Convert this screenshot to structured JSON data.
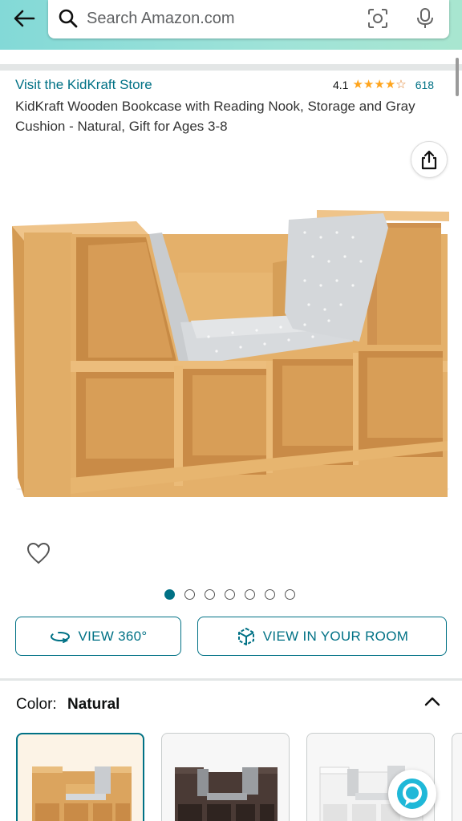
{
  "search": {
    "placeholder": "Search Amazon.com"
  },
  "store": {
    "link_text": "Visit the KidKraft Store"
  },
  "rating": {
    "value": "4.1",
    "stars": 4.1,
    "count": "618"
  },
  "product": {
    "title": "KidKraft Wooden Bookcase with Reading Nook, Storage and Gray Cushion - Natural, Gift for Ages 3-8"
  },
  "gallery": {
    "image_count": 7,
    "active_index": 0
  },
  "buttons": {
    "view_360": "VIEW 360°",
    "view_in_room": "VIEW IN YOUR ROOM"
  },
  "color": {
    "label": "Color:",
    "value": "Natural"
  },
  "swatches": [
    "Natural",
    "Espresso",
    "White"
  ],
  "colors": {
    "accent": "#007185",
    "star": "#ffa41c",
    "header_bg": "#9fe3d8",
    "wood": "#e2ad66"
  },
  "icons": [
    "back-arrow-icon",
    "search-icon",
    "camera-lens-icon",
    "microphone-icon",
    "share-icon",
    "heart-icon",
    "rotate-360-icon",
    "cube-ar-icon",
    "chevron-up-icon",
    "alexa-icon"
  ]
}
